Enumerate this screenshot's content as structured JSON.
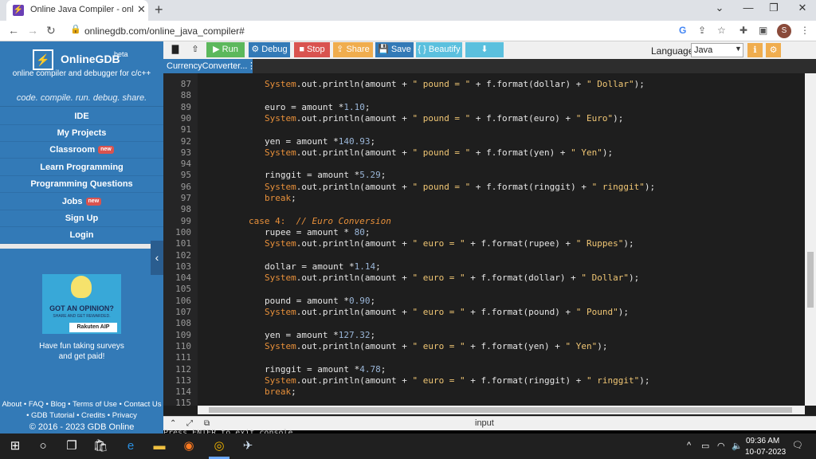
{
  "browser": {
    "tab_title": "Online Java Compiler - online ed",
    "new_tab": "+",
    "tab_close": "✕",
    "url": "onlinegdb.com/online_java_compiler#",
    "profile_initial": "S",
    "window_controls": [
      "⌄",
      "—",
      "❐",
      "✕"
    ]
  },
  "sidebar": {
    "brand_name": "OnlineGDB",
    "brand_sup": "beta",
    "brand_sub": "online compiler and debugger for c/c++",
    "slogan": "code. compile. run. debug. share.",
    "nav": [
      {
        "label": "IDE"
      },
      {
        "label": "My Projects"
      },
      {
        "label": "Classroom",
        "badge": "new"
      },
      {
        "label": "Learn Programming"
      },
      {
        "label": "Programming Questions"
      },
      {
        "label": "Jobs",
        "badge": "new"
      },
      {
        "label": "Sign Up"
      },
      {
        "label": "Login"
      }
    ],
    "ad": {
      "title": "GOT AN OPINION?",
      "subtitle": "SHARE AND GET REWARDED.",
      "brand": "Rakuten AIP",
      "text_line1": "Have fun taking surveys",
      "text_line2": "and get paid!"
    },
    "footer_line1": "About • FAQ • Blog • Terms of Use • Contact Us",
    "footer_line2": "• GDB Tutorial • Credits • Privacy",
    "copyright": "© 2016 - 2023 GDB Online"
  },
  "toolbar": {
    "run": "▶ Run",
    "debug": "⚙ Debug",
    "stop": "■ Stop",
    "share": "⇪ Share",
    "save": "💾 Save",
    "beautify": "{ } Beautify",
    "download_icon": "⬇",
    "language_label": "Language",
    "language_value": "Java",
    "colors": {
      "run": "#5cb85c",
      "debug": "#337ab7",
      "stop": "#d9534f",
      "share": "#f0ad4e",
      "save": "#337ab7",
      "beautify": "#5bc0de",
      "download": "#5bc0de"
    }
  },
  "editor": {
    "file_tab": "CurrencyConverter...",
    "lines": [
      {
        "n": "87",
        "kind": "println",
        "cur": "pound",
        "var": "dollar",
        "name": "Dollar"
      },
      {
        "n": "88",
        "kind": "blank"
      },
      {
        "n": "89",
        "kind": "assign",
        "var": "euro",
        "op": "*",
        "val": "1.10"
      },
      {
        "n": "90",
        "kind": "println",
        "cur": "pound",
        "var": "euro",
        "name": "Euro"
      },
      {
        "n": "91",
        "kind": "blank"
      },
      {
        "n": "92",
        "kind": "assign",
        "var": "yen",
        "op": "*",
        "val": "140.93"
      },
      {
        "n": "93",
        "kind": "println",
        "cur": "pound",
        "var": "yen",
        "name": "Yen"
      },
      {
        "n": "94",
        "kind": "blank"
      },
      {
        "n": "95",
        "kind": "assign",
        "var": "ringgit",
        "op": "*",
        "val": "5.29"
      },
      {
        "n": "96",
        "kind": "println",
        "cur": "pound",
        "var": "ringgit",
        "name": "ringgit"
      },
      {
        "n": "97",
        "kind": "break"
      },
      {
        "n": "98",
        "kind": "blank"
      },
      {
        "n": "99",
        "kind": "case",
        "label": "case 4:",
        "comment": "// Euro Conversion"
      },
      {
        "n": "100",
        "kind": "assign",
        "var": "rupee",
        "op": "* ",
        "val": "80"
      },
      {
        "n": "101",
        "kind": "println",
        "cur": "euro",
        "var": "rupee",
        "name": "Ruppes"
      },
      {
        "n": "102",
        "kind": "blank"
      },
      {
        "n": "103",
        "kind": "assign",
        "var": "dollar",
        "op": "*",
        "val": "1.14"
      },
      {
        "n": "104",
        "kind": "println",
        "cur": "euro",
        "var": "dollar",
        "name": "Dollar"
      },
      {
        "n": "105",
        "kind": "blank"
      },
      {
        "n": "106",
        "kind": "assign",
        "var": "pound",
        "op": "*",
        "val": "0.90"
      },
      {
        "n": "107",
        "kind": "println",
        "cur": "euro",
        "var": "pound",
        "name": "Pound"
      },
      {
        "n": "108",
        "kind": "blank"
      },
      {
        "n": "109",
        "kind": "assign",
        "var": "yen",
        "op": "*",
        "val": "127.32"
      },
      {
        "n": "110",
        "kind": "println",
        "cur": "euro",
        "var": "yen",
        "name": "Yen"
      },
      {
        "n": "111",
        "kind": "blank"
      },
      {
        "n": "112",
        "kind": "assign",
        "var": "ringgit",
        "op": "*",
        "val": "4.78"
      },
      {
        "n": "113",
        "kind": "println",
        "cur": "euro",
        "var": "ringgit",
        "name": "ringgit"
      },
      {
        "n": "114",
        "kind": "break"
      },
      {
        "n": "115",
        "kind": "blank"
      }
    ]
  },
  "io": {
    "label": "input",
    "console_text": "Press ENTER to exit console."
  },
  "taskbar": {
    "time": "09:36 AM",
    "date": "10-07-2023"
  }
}
